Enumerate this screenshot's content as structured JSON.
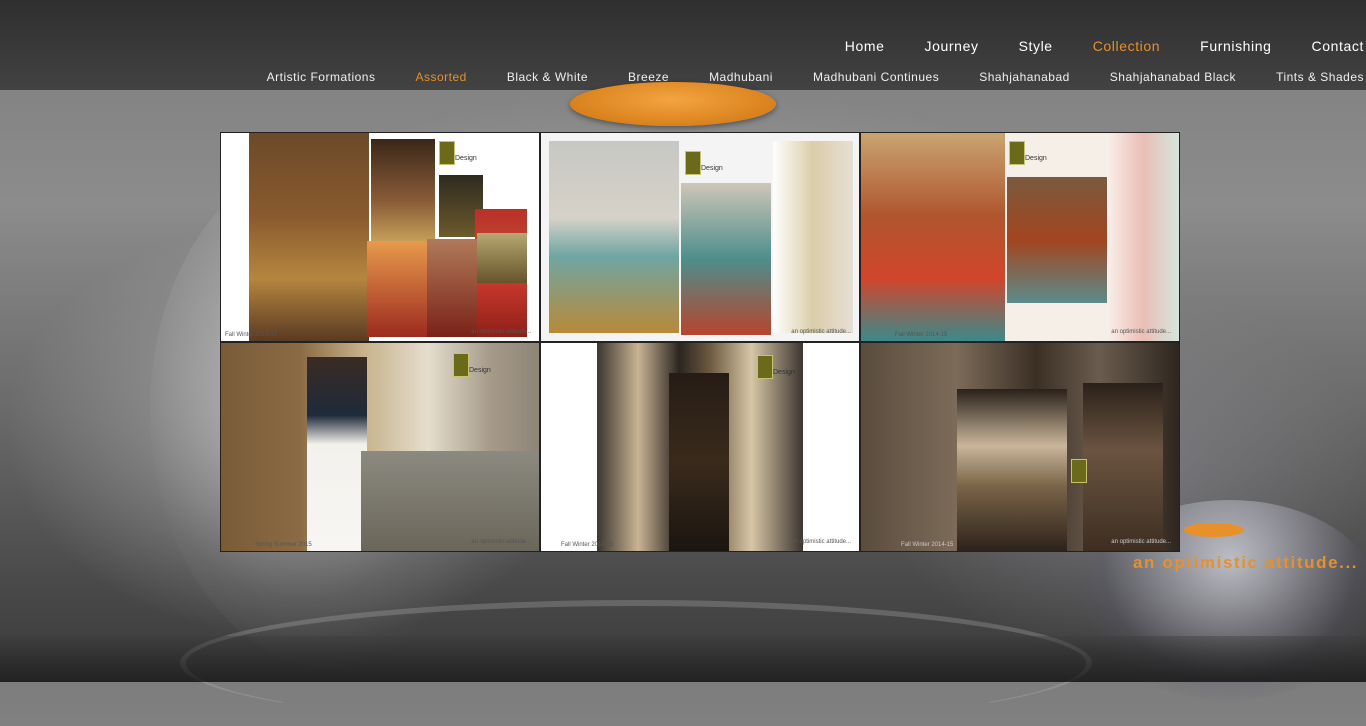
{
  "main_nav": [
    "Home",
    "Journey",
    "Style",
    "Collection",
    "Furnishing",
    "Contact"
  ],
  "main_nav_active": "Collection",
  "sub_nav": [
    "Artistic Formations",
    "Assorted",
    "Black & White",
    "Breeze",
    "Madhubani",
    "Madhubani Continues",
    "Shahjahanabad",
    "Shahjahanabad Black",
    "Tints & Shades"
  ],
  "sub_nav_active": "Assorted",
  "gallery": [
    {
      "label": "Fall Winter 2014-15",
      "tag": "an optimistic attitude..."
    },
    {
      "label": "",
      "tag": "an optimistic attitude..."
    },
    {
      "label": "Fall Winter 2014-15",
      "tag": "an optimistic attitude..."
    },
    {
      "label": "Spring Summer 2015",
      "tag": "an optimistic attitude..."
    },
    {
      "label": "Fall Winter 2014-15",
      "tag": "an optimistic attitude..."
    },
    {
      "label": "Fall Winter 2014-15",
      "tag": "an optimistic attitude..."
    }
  ],
  "brand_mark": "Design",
  "tagline": "an optimistic attitude...",
  "colors": {
    "accent": "#e8902a",
    "header_bg": "#3a3a3a",
    "nav_text": "#ffffff"
  }
}
